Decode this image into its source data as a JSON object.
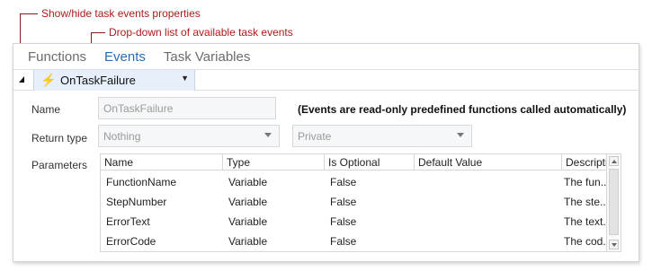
{
  "annotations": {
    "show_hide": "Show/hide task events properties",
    "dropdown": "Drop-down list of available task events"
  },
  "tabs": [
    {
      "label": "Functions",
      "active": false
    },
    {
      "label": "Events",
      "active": true
    },
    {
      "label": "Task Variables",
      "active": false
    }
  ],
  "event_select": {
    "value": "OnTaskFailure",
    "icon": "lightning-bolt-icon"
  },
  "form": {
    "name_label": "Name",
    "name_value": "OnTaskFailure",
    "note": "(Events are read-only predefined functions called automatically)",
    "return_type_label": "Return type",
    "return_type_value": "Nothing",
    "access_value": "Private",
    "parameters_label": "Parameters"
  },
  "grid": {
    "columns": [
      "Name",
      "Type",
      "Is Optional",
      "Default Value",
      "Description"
    ],
    "rows": [
      [
        "FunctionName",
        "Variable",
        "False",
        "",
        "The fun..."
      ],
      [
        "StepNumber",
        "Variable",
        "False",
        "",
        "The ste..."
      ],
      [
        "ErrorText",
        "Variable",
        "False",
        "",
        "The text..."
      ],
      [
        "ErrorCode",
        "Variable",
        "False",
        "",
        "The cod..."
      ]
    ]
  },
  "colors": {
    "accent": "#2b6cb0",
    "callout": "#b01a1a",
    "select_bg": "#e7f0fa",
    "bolt": "#f0a830"
  }
}
